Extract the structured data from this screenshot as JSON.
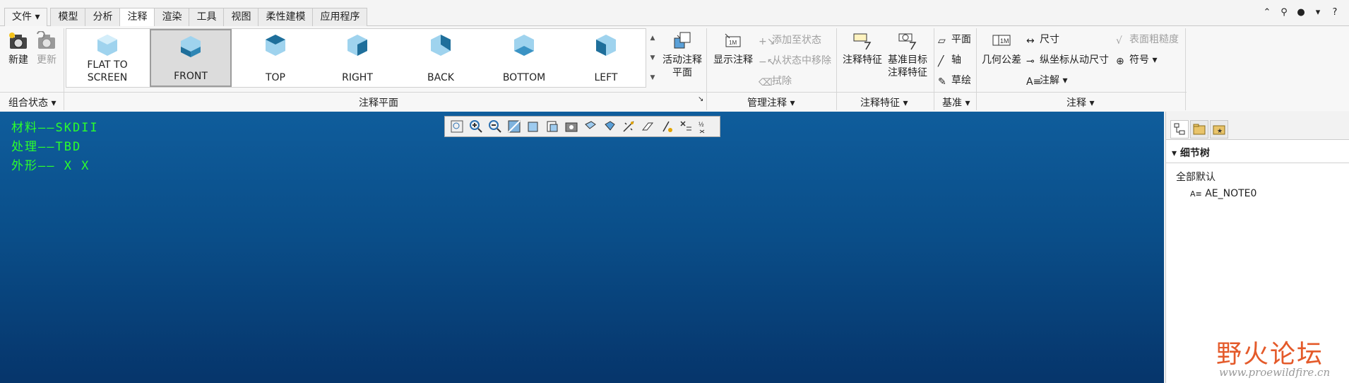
{
  "menu": {
    "file_label": "文件",
    "tabs": [
      "模型",
      "分析",
      "注释",
      "渲染",
      "工具",
      "视图",
      "柔性建模",
      "应用程序"
    ],
    "active_tab": "注释"
  },
  "window_icons": [
    "collapse-ribbon-icon",
    "search-icon",
    "user-icon",
    "dropdown-icon",
    "help-icon"
  ],
  "ribbon": {
    "combo_state": {
      "new_label": "新建",
      "update_label": "更新",
      "group_label": "组合状态"
    },
    "annotation_planes": {
      "items": [
        "FLAT TO\nSCREEN",
        "FRONT",
        "TOP",
        "RIGHT",
        "BACK",
        "BOTTOM",
        "LEFT"
      ],
      "selected": "FRONT",
      "active_plane_label": "活动注释\n平面",
      "group_label": "注释平面"
    },
    "manage": {
      "show_label": "显示注释",
      "add_to_state_label": "添加至状态",
      "remove_from_state_label": "从状态中移除",
      "erase_label": "拭除",
      "group_label": "管理注释"
    },
    "features": {
      "annotation_feature_label": "注释特征",
      "datum_target_label": "基准目标\n注释特征",
      "group_label": "注释特征"
    },
    "datum": {
      "plane_label": "平面",
      "axis_label": "轴",
      "sketch_label": "草绘",
      "group_label": "基准"
    },
    "annotations": {
      "gtol_label": "几何公差",
      "dimension_label": "尺寸",
      "ordinate_label": "纵坐标从动尺寸",
      "note_label": "注解",
      "surface_finish_label": "表面粗糙度",
      "symbol_label": "符号",
      "group_label": "注释"
    }
  },
  "canvas": {
    "notes": [
      "材料——SKDII",
      "处理——TBD",
      "外形——  X    X"
    ],
    "view_toolbar_icons": [
      "refit-icon",
      "zoom-in-icon",
      "zoom-out-icon",
      "repaint-icon",
      "display-style-icon",
      "saved-orientations-icon",
      "view-manager-icon",
      "perspective-icon",
      "spin-center-icon",
      "datum-display-icon",
      "annotation-display-icon",
      "hidden-line-icon",
      "wireframe-icon",
      "shading-icon"
    ],
    "background_top": "#0f5d9c",
    "background_bottom": "#06356b",
    "note_color": "#2cff2c"
  },
  "panel": {
    "title": "细节树",
    "items": [
      "全部默认",
      "AE_NOTE0"
    ]
  },
  "watermark": {
    "logo": "野火论坛",
    "url": "www.proewildfire.cn"
  }
}
